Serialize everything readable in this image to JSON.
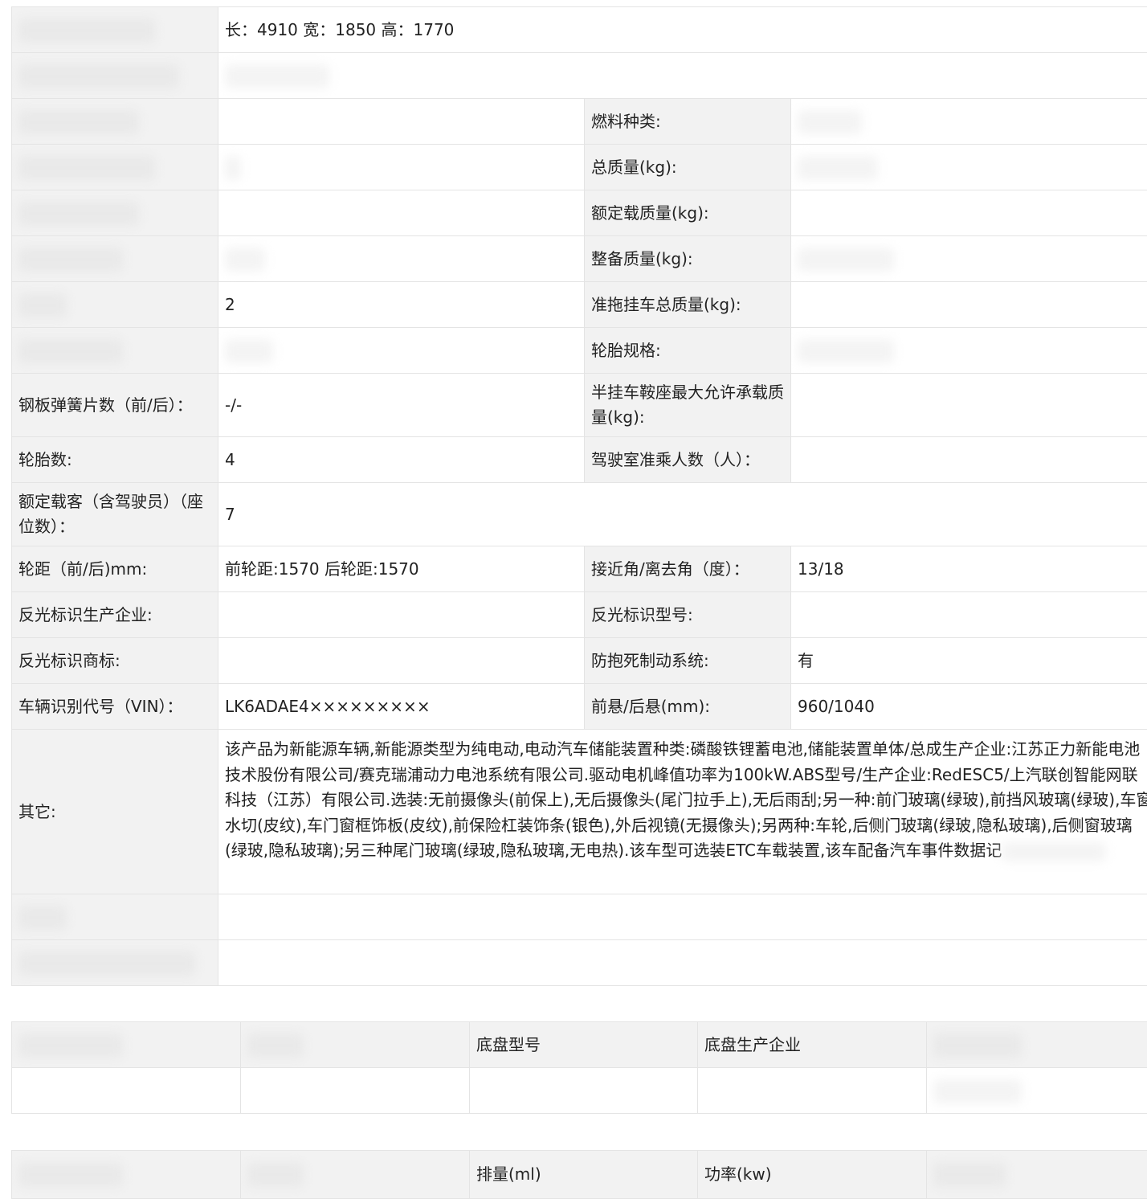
{
  "params": {
    "dimensions_value": "长：4910 宽：1850 高：1770",
    "fuel_type_label": "燃料种类:",
    "total_mass_label": "总质量(kg):",
    "rated_load_label": "额定载质量(kg):",
    "curb_weight_label": "整备质量(kg):",
    "row_axles_value": "2",
    "towing_mass_label": "准拖挂车总质量(kg):",
    "tire_spec_label": "轮胎规格:",
    "leaf_spring_label": "钢板弹簧片数（前/后）：",
    "leaf_spring_value": "-/-",
    "saddle_load_label": "半挂车鞍座最大允许承载质量(kg):",
    "tire_count_label": "轮胎数:",
    "tire_count_value": "4",
    "cab_passengers_label": "驾驶室准乘人数（人）：",
    "rated_passengers_label": "额定载客（含驾驶员）（座位数）：",
    "rated_passengers_value": "7",
    "track_label": "轮距（前/后)mm:",
    "track_value": "前轮距:1570 后轮距:1570",
    "approach_departure_label": "接近角/离去角（度）：",
    "approach_departure_value": "13/18",
    "reflector_maker_label": "反光标识生产企业:",
    "reflector_model_label": "反光标识型号:",
    "reflector_brand_label": "反光标识商标:",
    "abs_label": "防抱死制动系统:",
    "abs_value": "有",
    "vin_label": "车辆识别代号（VIN）：",
    "vin_value": "LK6ADAE4×××××××××",
    "overhang_label": "前悬/后悬(mm):",
    "overhang_value": "960/1040",
    "other_label": "其它:",
    "other_value": "该产品为新能源车辆,新能源类型为纯电动,电动汽车储能装置种类:磷酸铁锂蓄电池,储能装置单体/总成生产企业:江苏正力新能电池技术股份有限公司/赛克瑞浦动力电池系统有限公司.驱动电机峰值功率为100kW.ABS型号/生产企业:RedESC5/上汽联创智能网联科技（江苏）有限公司.选装:无前摄像头(前保上),无后摄像头(尾门拉手上),无后雨刮;另一种:前门玻璃(绿玻),前挡风玻璃(绿玻),车窗水切(皮纹),车门窗框饰板(皮纹),前保险杠装饰条(银色),外后视镜(无摄像头);另两种:车轮,后侧门玻璃(绿玻,隐私玻璃),后侧窗玻璃(绿玻,隐私玻璃);另三种尾门玻璃(绿玻,隐私玻璃,无电热).该车型可选装ETC车载装置,该车配备汽车事件数据记"
  },
  "chassis": {
    "header_model": "底盘型号",
    "header_maker": "底盘生产企业"
  },
  "engine": {
    "header_displacement": "排量(ml)",
    "header_power": "功率(kw)"
  }
}
